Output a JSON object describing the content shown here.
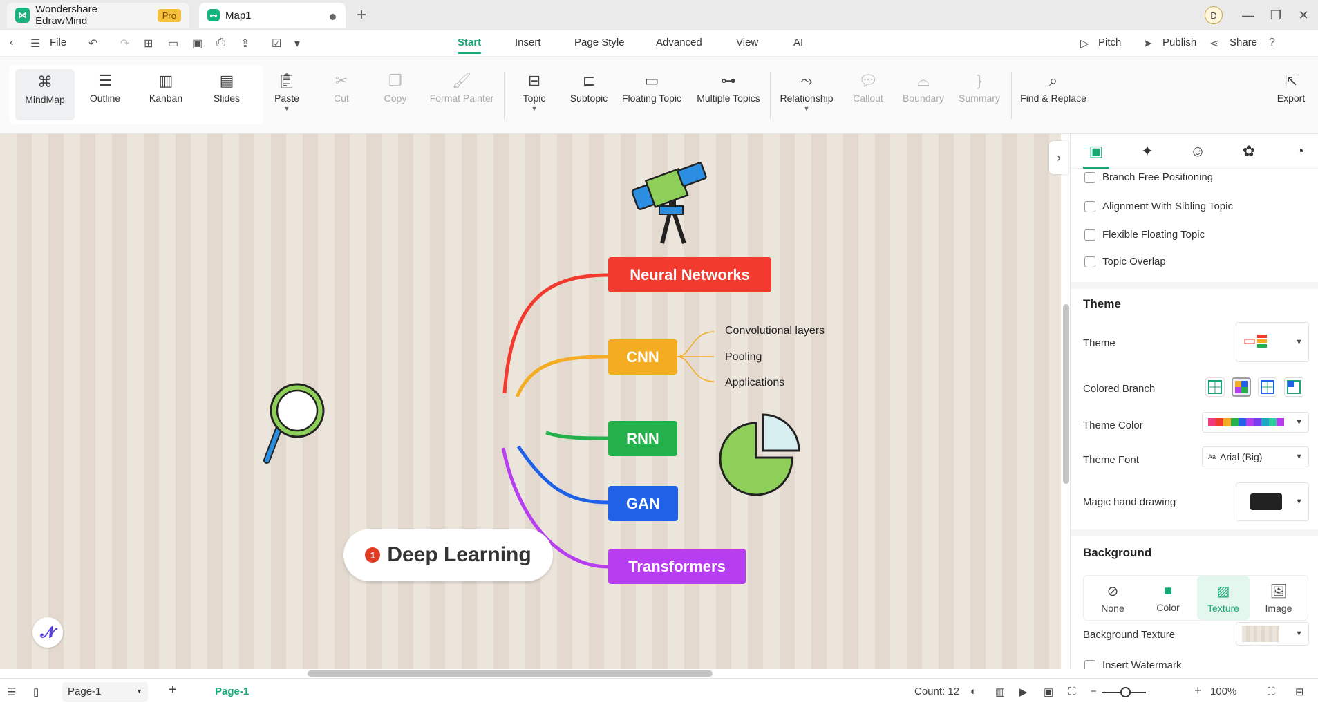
{
  "titlebar": {
    "app_title": "Wondershare EdrawMind",
    "pro_badge": "Pro",
    "doc_title": "Map1",
    "avatar_initial": "D"
  },
  "menubar": {
    "file_label": "File",
    "tabs": [
      "Start",
      "Insert",
      "Page Style",
      "Advanced",
      "View",
      "AI"
    ],
    "active_tab": "Start",
    "pitch_label": "Pitch",
    "publish_label": "Publish",
    "share_label": "Share"
  },
  "ribbon": {
    "views": [
      "MindMap",
      "Outline",
      "Kanban",
      "Slides"
    ],
    "selected_view": "MindMap",
    "clipboard": [
      "Paste",
      "Cut",
      "Copy",
      "Format Painter"
    ],
    "topics": [
      "Topic",
      "Subtopic",
      "Floating Topic",
      "Multiple Topics"
    ],
    "relations": [
      "Relationship",
      "Callout",
      "Boundary",
      "Summary"
    ],
    "find_replace": "Find & Replace",
    "export": "Export"
  },
  "mindmap": {
    "central": {
      "label": "Deep Learning",
      "badge": "1"
    },
    "topics": [
      {
        "label": "Neural Networks",
        "color": "#f23a2f"
      },
      {
        "label": "CNN",
        "color": "#f4ad23"
      },
      {
        "label": "RNN",
        "color": "#24b04b"
      },
      {
        "label": "GAN",
        "color": "#1f62e8"
      },
      {
        "label": "Transformers",
        "color": "#b63ef0"
      }
    ],
    "cnn_subtopics": [
      "Convolutional layers",
      "Pooling",
      "Applications"
    ]
  },
  "panel": {
    "options": [
      "Branch Free Positioning",
      "Alignment With Sibling Topic",
      "Flexible Floating Topic",
      "Topic Overlap"
    ],
    "theme_heading": "Theme",
    "theme_label": "Theme",
    "colored_branch_label": "Colored Branch",
    "theme_color_label": "Theme Color",
    "theme_font_label": "Theme Font",
    "theme_font_value": "Arial (Big)",
    "magic_hand_label": "Magic hand drawing",
    "background_heading": "Background",
    "background_options": [
      "None",
      "Color",
      "Texture",
      "Image"
    ],
    "selected_background": "Texture",
    "background_texture_label": "Background Texture",
    "insert_watermark_label": "Insert Watermark"
  },
  "statusbar": {
    "page_select": "Page-1",
    "page_tab": "Page-1",
    "count": "Count: 12",
    "zoom": "100%"
  },
  "colors": {
    "accent": "#18a874",
    "canvas_stripe_a": "#ece5dc",
    "canvas_stripe_b": "#e3d9cf"
  }
}
